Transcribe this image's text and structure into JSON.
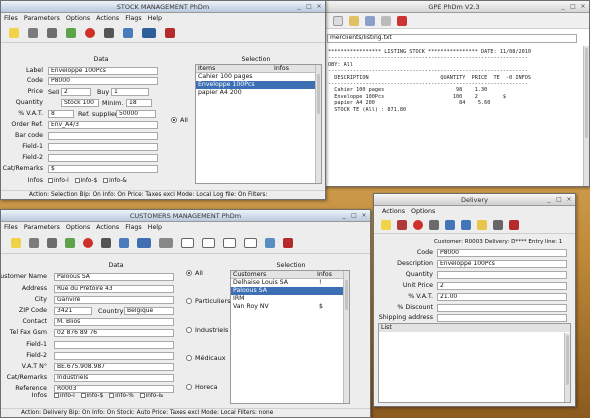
{
  "gpe": {
    "title": "GPE PhDm V2.3",
    "path": "merclients/listing.txt",
    "report": [
      "***************** LISTING STOCK **************** DATE: 11/08/2010",
      "----------------------------------------------------------------",
      "OBY: All",
      "",
      "----------------------------------------------------------------",
      "  DESCRIPTION                       QUANTITY  PRICE  TE  -0 INFOS",
      "----------------------------------------------------------------",
      "  Cahier 100 pages                       98    1.30",
      "  Enveloppe 100Pcs                      100    2        $",
      "  papier A4 200                           84    5.60",
      "",
      "  STOCK TE (All) : 871.80"
    ]
  },
  "stock": {
    "title": "STOCK MANAGEMENT  PhDm",
    "menu": [
      "Files",
      "Parameters",
      "Options",
      "Actions",
      "Flags",
      "Help"
    ],
    "data_header": "Data",
    "selection_header": "Selection",
    "fields": {
      "label": {
        "label": "Label",
        "value": "Enveloppe 100Pcs"
      },
      "code": {
        "label": "Code",
        "value": "P8000"
      },
      "price": {
        "label": "Price",
        "sell_label": "Sell",
        "sell": "2",
        "buy_label": "Buy",
        "buy": "1"
      },
      "quantity": {
        "label": "Quantity",
        "value": "Stock 100",
        "min_label": "Minim.",
        "min": "18"
      },
      "vat": {
        "label": "% V.A.T.",
        "value": "8",
        "ref_label": "Ref. supplier",
        "ref": "50000"
      },
      "order": {
        "label": "Order Ref.",
        "value": "Env_A4/3"
      },
      "barcode": {
        "label": "Bar code",
        "value": ""
      },
      "field1": {
        "label": "Field-1",
        "value": ""
      },
      "field2": {
        "label": "Field-2",
        "value": ""
      },
      "cat": {
        "label": "Cat/Remarks",
        "value": "$"
      },
      "infos": {
        "label": "Infos",
        "options": [
          "info-l",
          "info-$",
          "info-&"
        ]
      }
    },
    "radio_all": "All",
    "list_cols": [
      "Items",
      "Infos"
    ],
    "items": [
      "Cahier 100 pages",
      "Enveloppe 100Pcs",
      "papier A4 200"
    ],
    "selected_index": 1,
    "status": "Action: Selection   Bip: On   Info: On   Price: Taxes excl   Mode: Local   Log file: On  Filters:"
  },
  "customers": {
    "title": "CUSTOMERS MANAGEMENT  PhDm",
    "menu": [
      "Files",
      "Parameters",
      "Options",
      "Actions",
      "Flags",
      "Help"
    ],
    "data_header": "Data",
    "selection_header": "Selection",
    "fields": [
      {
        "label": "Customer Name",
        "value": "Paloous SA"
      },
      {
        "label": "Address",
        "value": "Rue du Prétoire 43"
      },
      {
        "label": "City",
        "value": "Ganvire"
      },
      {
        "label": "ZIP Code",
        "value": "3421",
        "extra_label": "Country",
        "extra": "Belgique"
      },
      {
        "label": "Contact",
        "value": "M. Blios"
      },
      {
        "label": "Tel Fax Gsm",
        "value": "02 876 89 76"
      },
      {
        "label": "Field-1",
        "value": ""
      },
      {
        "label": "Field-2",
        "value": ""
      },
      {
        "label": "V.A.T N°",
        "value": "BE.675.908.987"
      },
      {
        "label": "Cat/Remarks",
        "value": "Industriels"
      },
      {
        "label": "Reference",
        "value": "R0003"
      }
    ],
    "infos_label": "Infos",
    "infos_options": [
      "info-l",
      "info-$",
      "info-%",
      "info-&"
    ],
    "radios": [
      "All",
      "Particuliers",
      "Industriels",
      "Médicaux",
      "Horeca"
    ],
    "list_cols": [
      "Customers",
      "Infos"
    ],
    "rows": [
      {
        "name": "Delhaise Louis SA",
        "info": "!"
      },
      {
        "name": "Paloous SA",
        "info": ""
      },
      {
        "name": "IRM",
        "info": ""
      },
      {
        "name": "Van Roy NV",
        "info": "$"
      }
    ],
    "selected_index": 1,
    "status": "Action: Delivery   Bip: On   Info: On   Stock: Auto   Price: Taxes excl   Mode: Local   Filters: none"
  },
  "delivery": {
    "title": "Delivery",
    "menu": [
      "Actions",
      "Options"
    ],
    "customer_line": "Customer: R0003  Delivery: D**** Entry line: 1",
    "fields": [
      {
        "label": "Code",
        "value": "P8000"
      },
      {
        "label": "Description",
        "value": "Enveloppe 100Pcs"
      },
      {
        "label": "Quantity",
        "value": ""
      },
      {
        "label": "Unit Price",
        "value": "2"
      },
      {
        "label": "% V.A.T.",
        "value": "21.00"
      },
      {
        "label": "% Discount",
        "value": ""
      },
      {
        "label": "Shipping address",
        "value": ""
      }
    ],
    "list_label": "List"
  },
  "colors": {
    "selection": "#3d6fb4",
    "titlebar_active": "#b9c9dd",
    "window_bg": "#ededed"
  }
}
